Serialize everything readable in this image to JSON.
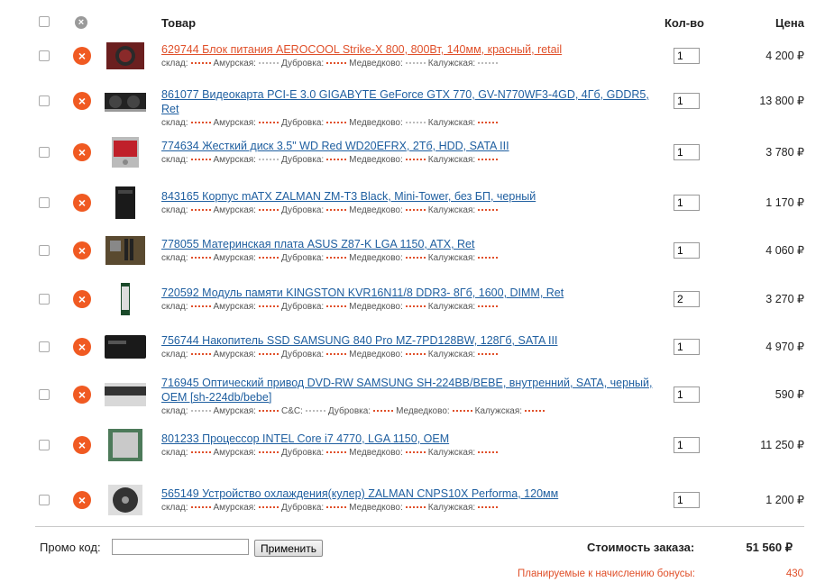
{
  "header": {
    "goods": "Товар",
    "qty": "Кол-во",
    "price": "Цена"
  },
  "stock_labels": {
    "warehouse": "склад:",
    "s1": "Амурская:",
    "s2": "Дубровка:",
    "s3": "Медведково:",
    "s4": "Калужская:",
    "cc": "С&С:"
  },
  "items": [
    {
      "title": "629744 Блок питания AEROCOOL Strike-X 800, 800Вт, 140мм, красный, retail",
      "qty": "1",
      "price": "4 200 ₽",
      "thumb": "psu"
    },
    {
      "title": "861077 Видеокарта PCI-E 3.0 GIGABYTE GeForce GTX 770, GV-N770WF3-4GD, 4Гб, GDDR5, Ret",
      "qty": "1",
      "price": "13 800 ₽",
      "thumb": "gpu"
    },
    {
      "title": "774634 Жесткий диск 3.5\" WD Red WD20EFRX, 2Тб, HDD, SATA III",
      "qty": "1",
      "price": "3 780 ₽",
      "thumb": "hdd"
    },
    {
      "title": "843165 Корпус mATX ZALMAN ZM-T3 Black, Mini-Tower, без БП, черный",
      "qty": "1",
      "price": "1 170 ₽",
      "thumb": "case"
    },
    {
      "title": "778055 Материнская плата ASUS Z87-K LGA 1150, ATX, Ret",
      "qty": "1",
      "price": "4 060 ₽",
      "thumb": "mb"
    },
    {
      "title": "720592 Модуль памяти KINGSTON KVR16N11/8 DDR3- 8Гб, 1600, DIMM, Ret",
      "qty": "2",
      "price": "3 270 ₽",
      "thumb": "ram"
    },
    {
      "title": "756744 Накопитель SSD SAMSUNG 840 Pro MZ-7PD128BW, 128Гб, SATA III",
      "qty": "1",
      "price": "4 970 ₽",
      "thumb": "ssd"
    },
    {
      "title": "716945 Оптический привод DVD-RW SAMSUNG SH-224BB/BEBE, внутренний, SATA, черный, OEM [sh-224db/bebe]",
      "qty": "1",
      "price": "590 ₽",
      "thumb": "dvd"
    },
    {
      "title": "801233 Процессор INTEL Core i7 4770, LGA 1150, OEM",
      "qty": "1",
      "price": "11 250 ₽",
      "thumb": "cpu"
    },
    {
      "title": "565149 Устройство охлаждения(кулер) ZALMAN CNPS10X Performa, 120мм",
      "qty": "1",
      "price": "1 200 ₽",
      "thumb": "cooler"
    }
  ],
  "footer": {
    "promo_label": "Промо код:",
    "promo_value": "",
    "apply_label": "Применить",
    "total_label": "Стоимость заказа:",
    "total_value": "51 560 ₽",
    "bonus_label": "Планируемые к начислению бонусы:",
    "bonus_value": "430"
  },
  "colors": {
    "accent": "#f05a22",
    "link": "#1f5fa0",
    "active_link": "#e0502a"
  }
}
